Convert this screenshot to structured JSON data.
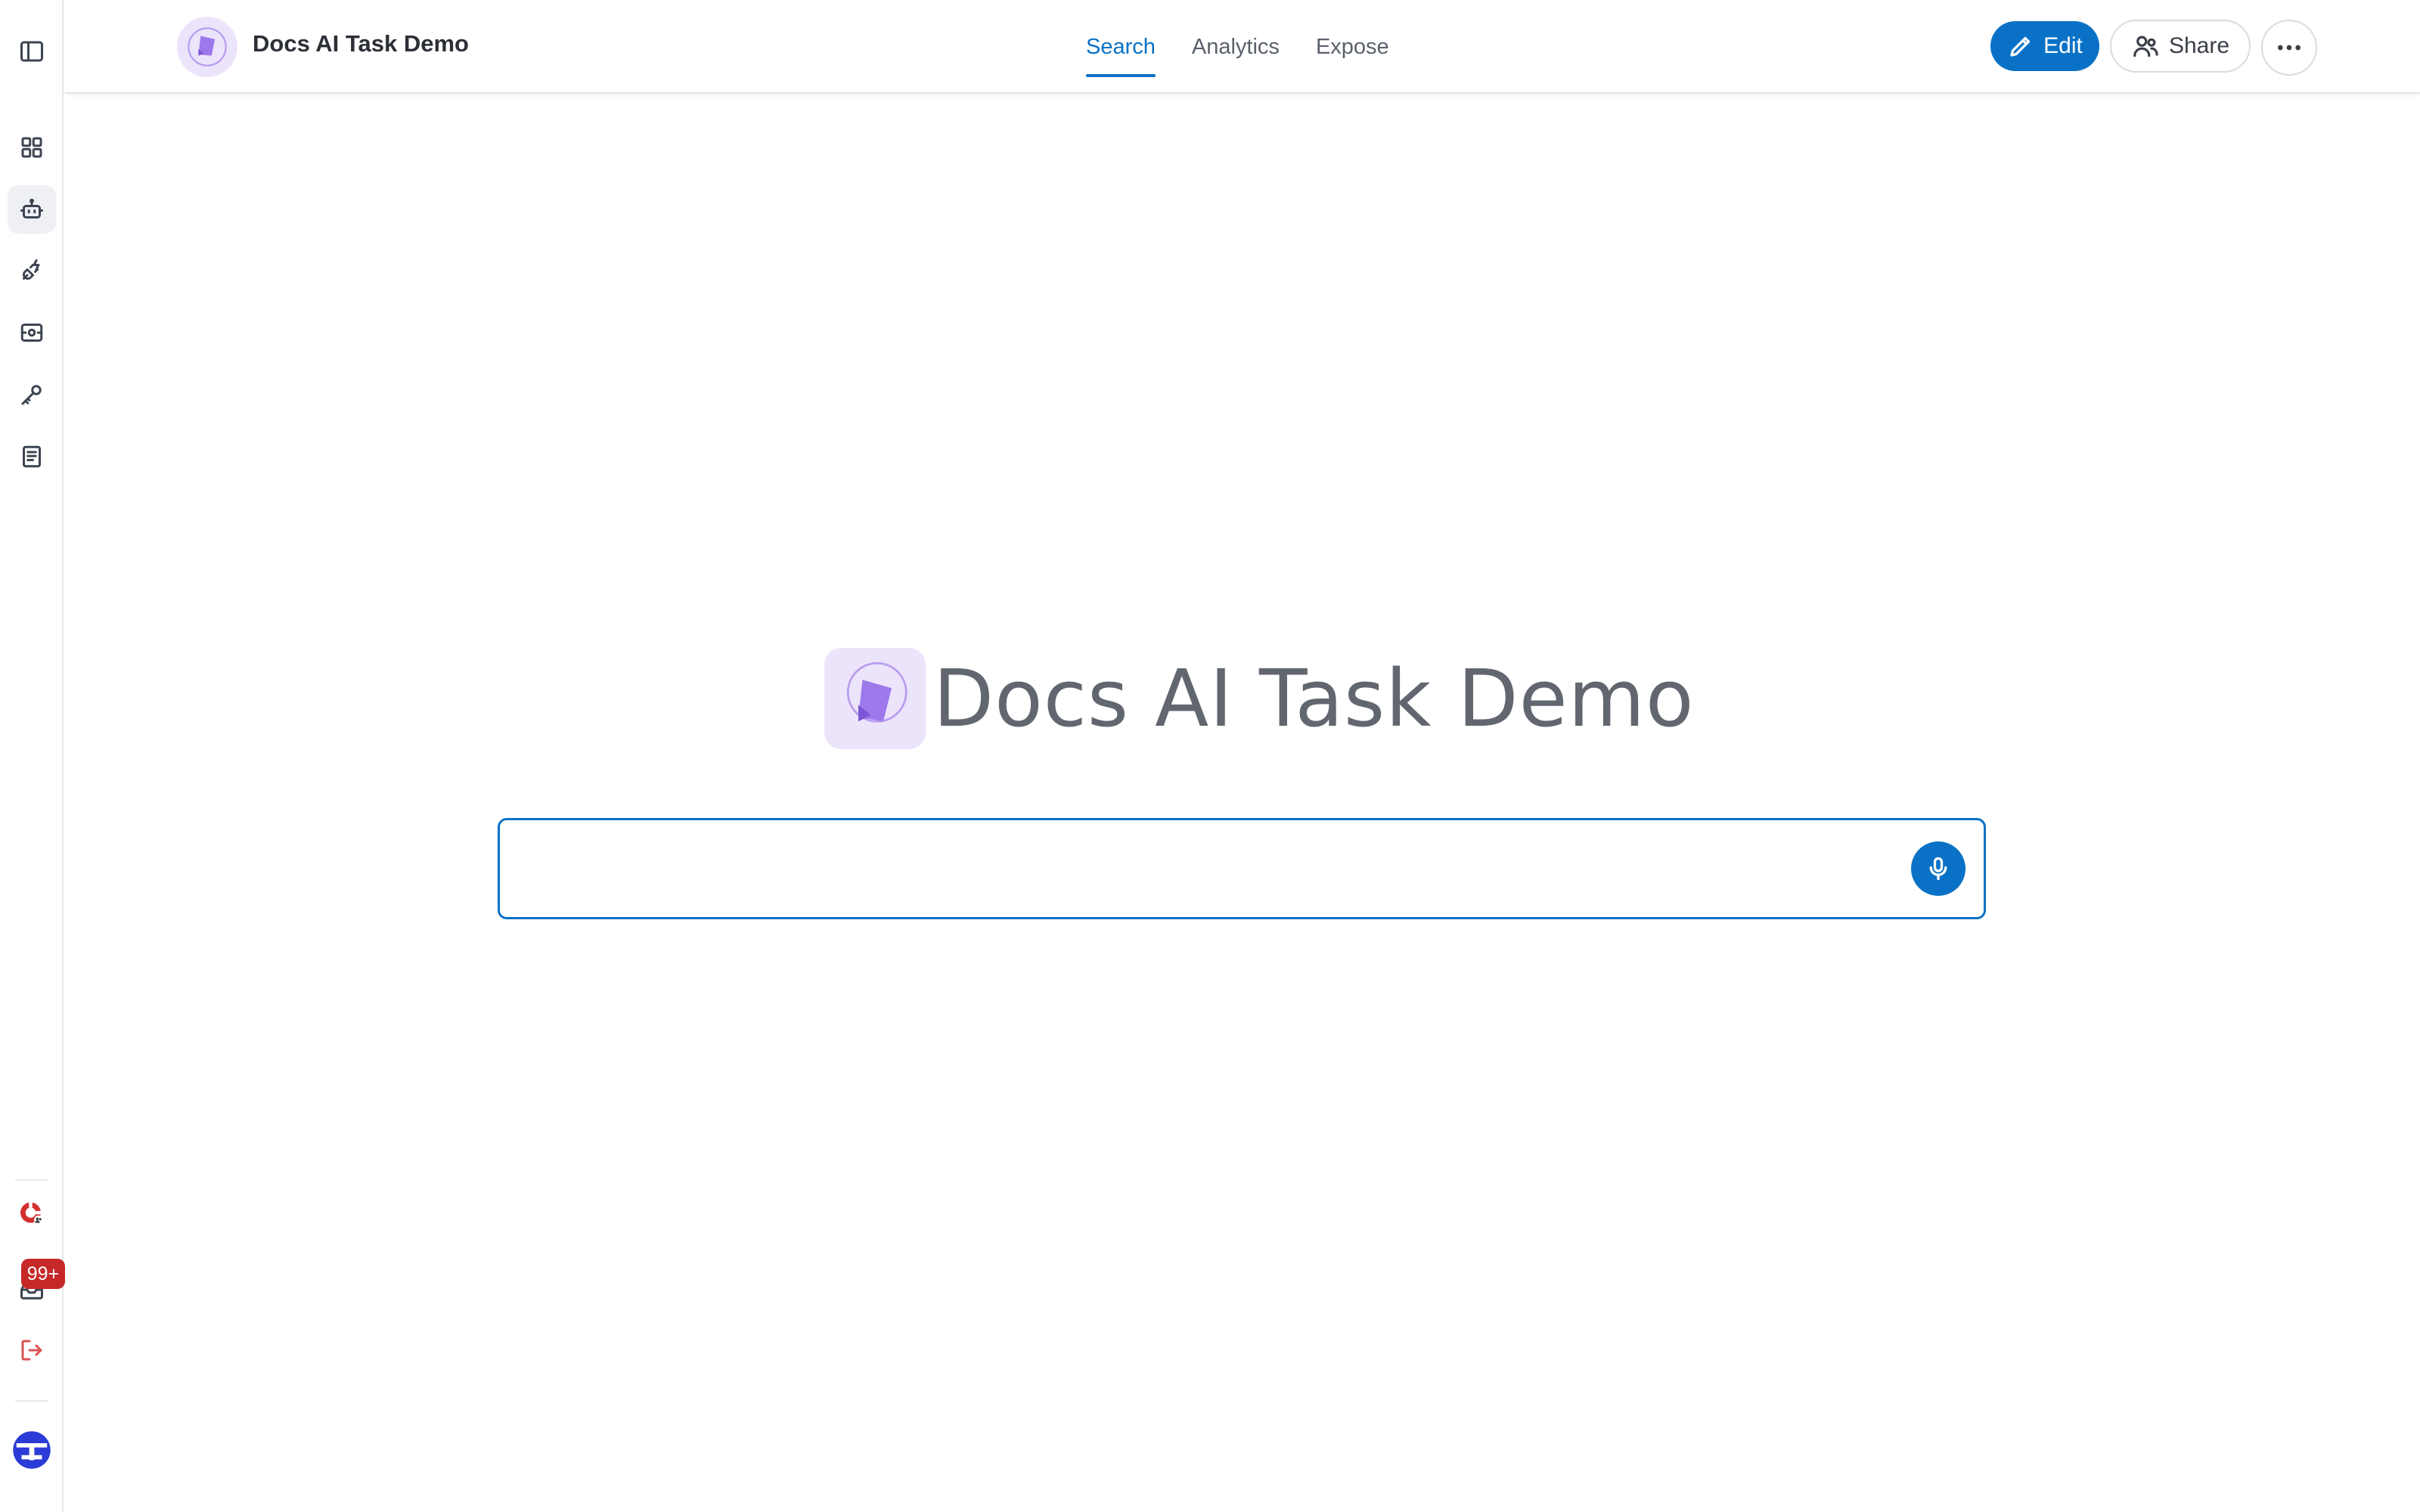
{
  "app": {
    "title": "Docs AI Task Demo",
    "logo_icon": "docs-ai-logo-icon",
    "accent_color": "#0a72c6",
    "logo_bg_color": "#ece4fb"
  },
  "header": {
    "tabs": [
      {
        "label": "Search",
        "active": true
      },
      {
        "label": "Analytics",
        "active": false
      },
      {
        "label": "Expose",
        "active": false
      }
    ],
    "edit_label": "Edit",
    "share_label": "Share",
    "more_icon": "more-horizontal-icon"
  },
  "sidebar": {
    "toggle_icon": "sidebar-toggle-icon",
    "items": [
      {
        "icon": "grid-icon",
        "active": false
      },
      {
        "icon": "bot-icon",
        "active": true
      },
      {
        "icon": "plug-icon",
        "active": false
      },
      {
        "icon": "scan-icon",
        "active": false
      },
      {
        "icon": "key-icon",
        "active": false
      },
      {
        "icon": "document-icon",
        "active": false
      }
    ],
    "bottom": {
      "support_icon": "support-lifebuoy-icon",
      "inbox_icon": "inbox-icon",
      "inbox_badge": "99+",
      "logout_icon": "logout-icon",
      "avatar_icon": "user-avatar"
    }
  },
  "main": {
    "hero_title": "Docs AI Task Demo",
    "search": {
      "value": "",
      "placeholder": ""
    },
    "mic_icon": "microphone-icon"
  }
}
